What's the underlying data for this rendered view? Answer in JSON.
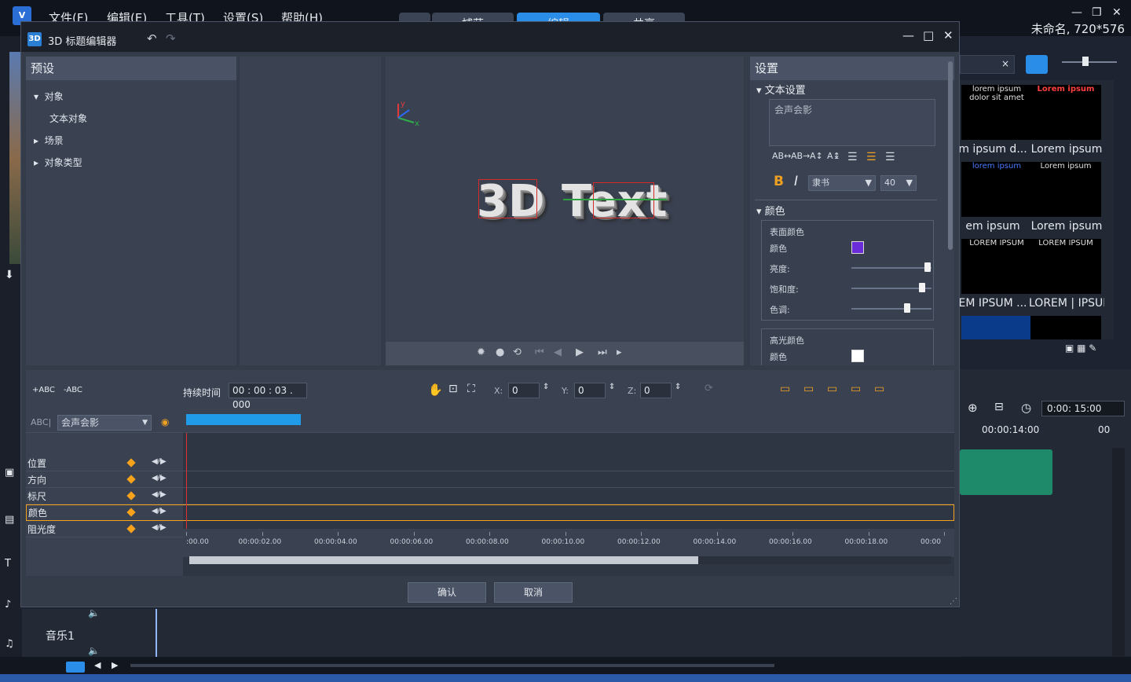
{
  "app": {
    "menus": [
      "文件(F)",
      "编辑(E)",
      "工具(T)",
      "设置(S)",
      "帮助(H)"
    ],
    "tabs": [
      "捕获",
      "编辑",
      "共享"
    ],
    "title": "未命名, 720*576",
    "library": {
      "items": [
        {
          "label": "m ipsum d...",
          "preview": "lorem ipsum dolor sit amet"
        },
        {
          "label": "Lorem ipsum",
          "preview": "Lorem ipsum"
        },
        {
          "label": "em ipsum",
          "preview": "lorem ipsum"
        },
        {
          "label": "Lorem ipsum",
          "preview": "Lorem ipsum"
        },
        {
          "label": "EM IPSUM ...",
          "preview": "LOREM IPSUM"
        },
        {
          "label": "LOREM | IPSUM",
          "preview": "LOREM IPSUM"
        }
      ],
      "search_clear": "×"
    },
    "timeline": {
      "timecode": "0:00: 15:00",
      "ruler_label": "00:00:14:00",
      "ruler_label_2": "00",
      "music_track": "音乐1"
    }
  },
  "dialog": {
    "title": "3D 标题编辑器",
    "presets": {
      "header": "预设",
      "tree": [
        {
          "label": "对象",
          "expanded": true,
          "level": 0
        },
        {
          "label": "文本对象",
          "level": 1
        },
        {
          "label": "场景",
          "expanded": false,
          "level": 0
        },
        {
          "label": "对象类型",
          "expanded": false,
          "level": 0
        }
      ]
    },
    "preview": {
      "text": "3D Text",
      "axis_y": "y",
      "axis_x": "x"
    },
    "settings": {
      "header": "设置",
      "text_section": "文本设置",
      "text_value": "会声会影",
      "font": "隶书",
      "font_size": "40",
      "color_section": "颜色",
      "surface": {
        "title": "表面颜色",
        "color_label": "颜色",
        "color": "#6a2bd8",
        "brightness_label": "亮度:",
        "brightness": 0.95,
        "saturation_label": "饱和度:",
        "saturation": 0.88,
        "hue_label": "色调:",
        "hue": 0.7
      },
      "highlight": {
        "title": "高光颜色",
        "color_label": "颜色",
        "color": "#ffffff"
      }
    },
    "toolbar": {
      "add_text": "+ABC",
      "remove_text": "-ABC",
      "duration_label": "持续时间",
      "duration": "00 : 00 : 03 . 000",
      "x_label": "X:",
      "x": "0",
      "y_label": "Y:",
      "y": "0",
      "z_label": "Z:",
      "z": "0"
    },
    "keyframes": {
      "object_prefix": "ABC|",
      "object": "会声会影",
      "rows": [
        "位置",
        "方向",
        "标尺",
        "颜色",
        "阻光度"
      ],
      "selected_row": "颜色",
      "ruler": [
        ":00.00",
        "00:00:02.00",
        "00:00:04.00",
        "00:00:06.00",
        "00:00:08.00",
        "00:00:10.00",
        "00:00:12.00",
        "00:00:14.00",
        "00:00:16.00",
        "00:00:18.00",
        "00:00"
      ]
    },
    "ok": "确认",
    "cancel": "取消"
  }
}
